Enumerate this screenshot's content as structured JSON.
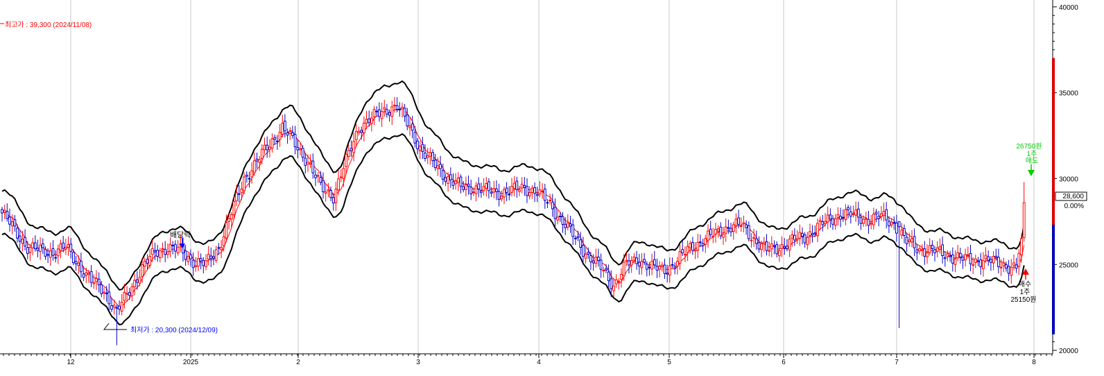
{
  "chart_data": {
    "type": "candlestick",
    "y_range": [
      19800,
      40400
    ],
    "y_ticks": [
      20000,
      25000,
      30000,
      35000,
      40000
    ],
    "x_tick_labels": [
      "12",
      "2025",
      "2",
      "3",
      "4",
      "5",
      "6",
      "7",
      "8"
    ],
    "grid": "vertical",
    "current_price": "28,600",
    "change_pct": "0.00%",
    "colors": {
      "up": "#ff0000",
      "down": "#0000cc",
      "ma": "#ff0000",
      "bands": "#000000"
    },
    "high_note": {
      "text": "최고가 : 39,300 (2024/11/08)",
      "color": "#ff0000"
    },
    "low_note": {
      "text": "최저가 : 20,300 (2024/12/09)",
      "value": 20300,
      "color": "#0000ff"
    },
    "markers": [
      {
        "text": "배당락",
        "color": "#000000"
      },
      {
        "text": "26750원 1주 매도",
        "color": "#00cc00"
      },
      {
        "text": "매수 1주 25150원",
        "color": "#000000"
      }
    ],
    "anchors": [
      {
        "d": 0,
        "c": 28000
      },
      {
        "d": 5,
        "c": 27000
      },
      {
        "d": 10,
        "c": 26000
      },
      {
        "d": 15,
        "c": 25800
      },
      {
        "d": 20,
        "c": 25700
      },
      {
        "d": 25,
        "c": 26000
      },
      {
        "d": 30,
        "c": 25000
      },
      {
        "d": 35,
        "c": 24000
      },
      {
        "d": 40,
        "c": 23500
      },
      {
        "d": 45,
        "c": 22200
      },
      {
        "d": 50,
        "c": 23500
      },
      {
        "d": 55,
        "c": 24800
      },
      {
        "d": 60,
        "c": 25700
      },
      {
        "d": 65,
        "c": 26000
      },
      {
        "d": 70,
        "c": 25800
      },
      {
        "d": 75,
        "c": 25200
      },
      {
        "d": 80,
        "c": 25000
      },
      {
        "d": 85,
        "c": 26000
      },
      {
        "d": 90,
        "c": 28000
      },
      {
        "d": 95,
        "c": 30000
      },
      {
        "d": 100,
        "c": 31000
      },
      {
        "d": 105,
        "c": 32000
      },
      {
        "d": 110,
        "c": 33000
      },
      {
        "d": 115,
        "c": 32000
      },
      {
        "d": 120,
        "c": 31000
      },
      {
        "d": 125,
        "c": 29500
      },
      {
        "d": 130,
        "c": 29000
      },
      {
        "d": 135,
        "c": 31000
      },
      {
        "d": 140,
        "c": 33000
      },
      {
        "d": 145,
        "c": 33500
      },
      {
        "d": 150,
        "c": 34000
      },
      {
        "d": 155,
        "c": 34200
      },
      {
        "d": 160,
        "c": 33000
      },
      {
        "d": 165,
        "c": 31500
      },
      {
        "d": 170,
        "c": 30800
      },
      {
        "d": 175,
        "c": 30000
      },
      {
        "d": 180,
        "c": 29500
      },
      {
        "d": 185,
        "c": 29500
      },
      {
        "d": 190,
        "c": 29300
      },
      {
        "d": 195,
        "c": 29200
      },
      {
        "d": 200,
        "c": 29300
      },
      {
        "d": 205,
        "c": 29500
      },
      {
        "d": 210,
        "c": 29200
      },
      {
        "d": 215,
        "c": 28500
      },
      {
        "d": 220,
        "c": 27500
      },
      {
        "d": 225,
        "c": 26500
      },
      {
        "d": 230,
        "c": 25500
      },
      {
        "d": 235,
        "c": 24800
      },
      {
        "d": 240,
        "c": 23800
      },
      {
        "d": 245,
        "c": 25000
      },
      {
        "d": 250,
        "c": 25300
      },
      {
        "d": 255,
        "c": 24800
      },
      {
        "d": 260,
        "c": 24700
      },
      {
        "d": 265,
        "c": 25200
      },
      {
        "d": 270,
        "c": 26000
      },
      {
        "d": 275,
        "c": 26400
      },
      {
        "d": 280,
        "c": 26800
      },
      {
        "d": 285,
        "c": 27200
      },
      {
        "d": 290,
        "c": 27300
      },
      {
        "d": 295,
        "c": 26500
      },
      {
        "d": 300,
        "c": 25800
      },
      {
        "d": 305,
        "c": 26000
      },
      {
        "d": 310,
        "c": 26400
      },
      {
        "d": 315,
        "c": 26600
      },
      {
        "d": 320,
        "c": 27200
      },
      {
        "d": 325,
        "c": 27600
      },
      {
        "d": 330,
        "c": 28000
      },
      {
        "d": 335,
        "c": 27800
      },
      {
        "d": 340,
        "c": 27600
      },
      {
        "d": 345,
        "c": 27800
      },
      {
        "d": 350,
        "c": 27400
      },
      {
        "d": 355,
        "c": 26300
      },
      {
        "d": 360,
        "c": 25900
      },
      {
        "d": 365,
        "c": 25800
      },
      {
        "d": 370,
        "c": 25600
      },
      {
        "d": 375,
        "c": 25400
      },
      {
        "d": 380,
        "c": 25200
      },
      {
        "d": 385,
        "c": 25300
      },
      {
        "d": 390,
        "c": 25100
      },
      {
        "d": 395,
        "c": 24900
      },
      {
        "d": 398,
        "c": 24800
      },
      {
        "d": 400,
        "c": 26500
      },
      {
        "d": 401,
        "c": 28600
      }
    ]
  },
  "plot_labels": {
    "high": "최고가 : 39,300 (2024/11/08)",
    "low": "최저가 : 20,300 (2024/12/09)",
    "dividend": "배당락",
    "sell_price": "26750원",
    "sell_qty": "1주",
    "sell_action": "매도",
    "buy_action": "매수",
    "buy_qty": "1주",
    "buy_price": "25150원"
  }
}
